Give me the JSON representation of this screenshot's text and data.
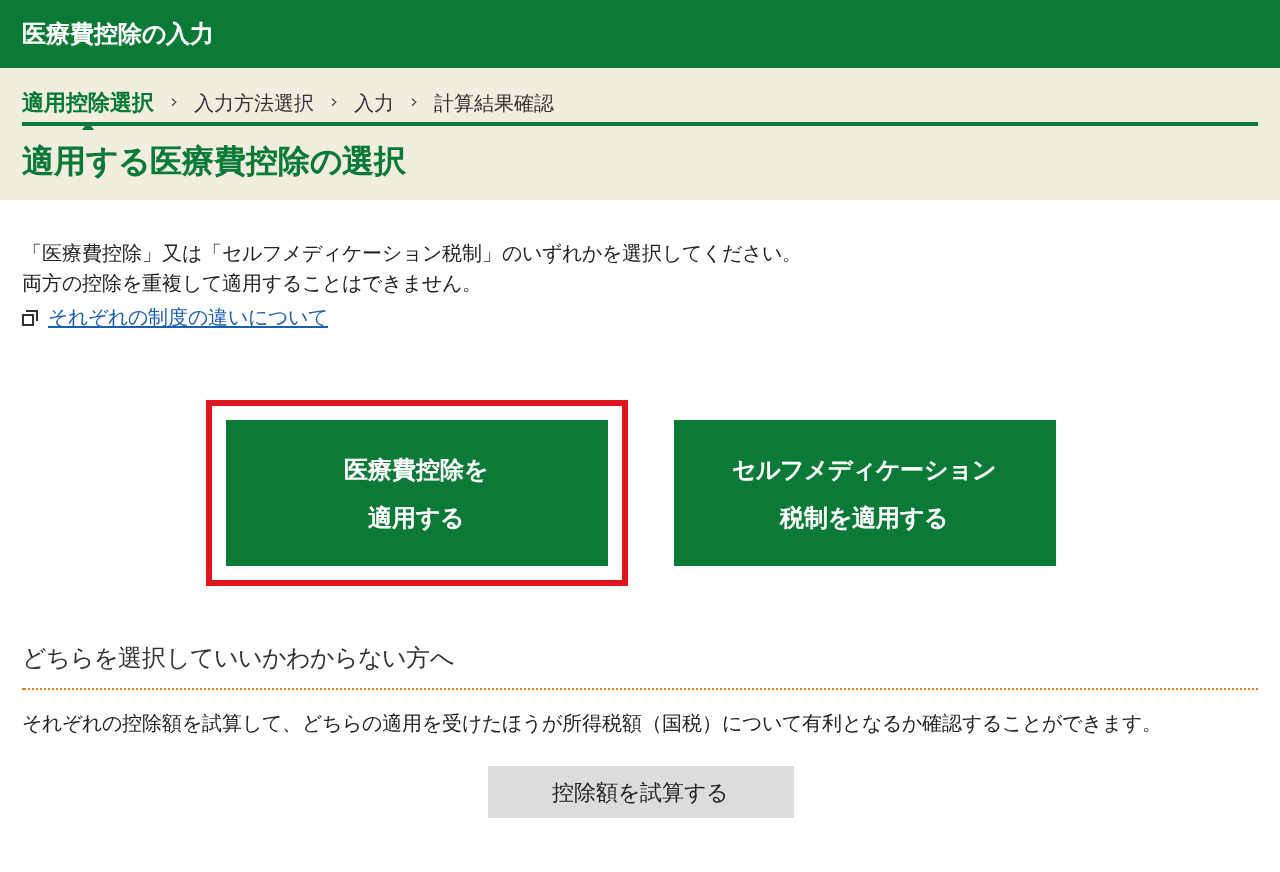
{
  "header": {
    "title": "医療費控除の入力"
  },
  "steps": [
    {
      "label": "適用控除選択",
      "selected": true
    },
    {
      "label": "入力方法選択",
      "selected": false
    },
    {
      "label": "入力",
      "selected": false
    },
    {
      "label": "計算結果確認",
      "selected": false
    }
  ],
  "step_separator": "›",
  "page_title": "適用する医療費控除の選択",
  "intro_lines": [
    "「医療費控除」又は「セルフメディケーション税制」のいずれかを選択してください。",
    "両方の控除を重複して適用することはできません。"
  ],
  "help_link": "それぞれの制度の違いについて",
  "choices": [
    {
      "lines": [
        "医療費控除を",
        "適用する"
      ],
      "highlighted": true
    },
    {
      "lines": [
        "セルフメディケーション",
        "税制を適用する"
      ],
      "highlighted": false
    }
  ],
  "help_section": {
    "heading": "どちらを選択していいかわからない方へ",
    "text": "それぞれの控除額を試算して、どちらの適用を受けたほうが所得税額（国税）について有利となるか確認することができます。",
    "button": "控除額を試算する"
  }
}
